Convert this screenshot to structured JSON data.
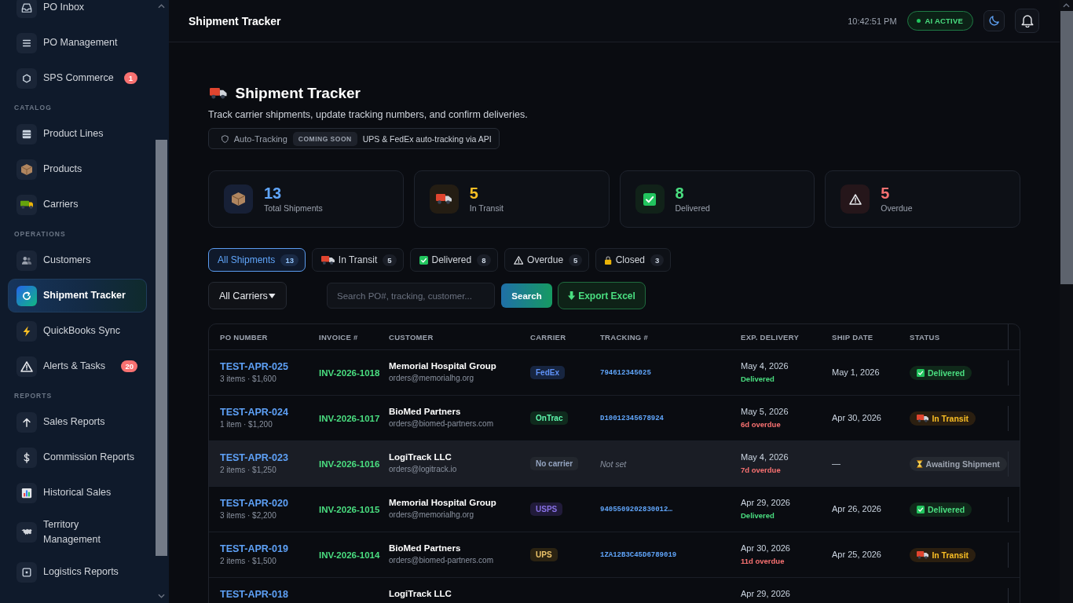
{
  "sidebar": {
    "groups": [
      {
        "items": [
          {
            "label": "PO Inbox",
            "kind": "inbox",
            "selected": false
          },
          {
            "label": "PO Management",
            "kind": "list",
            "selected": false
          },
          {
            "label": "SPS Commerce",
            "kind": "hexagon",
            "selected": false,
            "badge": "1"
          }
        ]
      },
      {
        "label": "CATALOG",
        "items": [
          {
            "label": "Product Lines",
            "kind": "table",
            "selected": false
          },
          {
            "label": "Products",
            "kind": "box",
            "selected": false
          },
          {
            "label": "Carriers",
            "kind": "lorry",
            "selected": false
          }
        ]
      },
      {
        "label": "OPERATIONS",
        "items": [
          {
            "label": "Customers",
            "kind": "people",
            "selected": false
          },
          {
            "label": "Shipment Tracker",
            "kind": "refresh",
            "selected": true
          },
          {
            "label": "QuickBooks Sync",
            "kind": "bolt",
            "selected": false
          },
          {
            "label": "Alerts & Tasks",
            "kind": "warning",
            "selected": false,
            "badge": "20"
          }
        ]
      },
      {
        "label": "REPORTS",
        "items": [
          {
            "label": "Sales Reports",
            "kind": "arrow",
            "selected": false
          },
          {
            "label": "Commission Reports",
            "kind": "dollar",
            "selected": false
          },
          {
            "label": "Historical Sales",
            "kind": "chart",
            "selected": false
          },
          {
            "label": "Territory Management",
            "kind": "map",
            "selected": false
          },
          {
            "label": "Logistics Reports",
            "kind": "square",
            "selected": false
          }
        ]
      }
    ]
  },
  "header": {
    "title": "Shipment Tracker",
    "time": "10:42:51 PM",
    "status": "AI ACTIVE"
  },
  "page": {
    "title": "Shipment Tracker",
    "subtitle": "Track carrier shipments, update tracking numbers, and confirm deliveries.",
    "notice": {
      "label": "Auto-Tracking",
      "badge": "COMING SOON",
      "text": "UPS & FedEx auto-tracking via API"
    }
  },
  "stats": [
    {
      "value": "13",
      "label": "Total Shipments",
      "kind": "total"
    },
    {
      "value": "5",
      "label": "In Transit",
      "kind": "transit"
    },
    {
      "value": "8",
      "label": "Delivered",
      "kind": "delivered"
    },
    {
      "value": "5",
      "label": "Overdue",
      "kind": "overdue"
    }
  ],
  "tabs": [
    {
      "label": "All Shipments",
      "count": "13",
      "kind": "all",
      "selected": true
    },
    {
      "label": "In Transit",
      "count": "5",
      "kind": "transit",
      "selected": false
    },
    {
      "label": "Delivered",
      "count": "8",
      "kind": "delivered",
      "selected": false
    },
    {
      "label": "Overdue",
      "count": "5",
      "kind": "overdue",
      "selected": false
    },
    {
      "label": "Closed",
      "count": "3",
      "kind": "closed",
      "selected": false
    }
  ],
  "filters": {
    "carrier": "All Carriers",
    "search": {
      "placeholder": "Search PO#, tracking, customer..."
    },
    "buttons": [
      {
        "label": "Search",
        "kind": "search"
      },
      {
        "label": "Export Excel",
        "kind": "export"
      }
    ]
  },
  "table": {
    "columns": [
      "PO NUMBER",
      "INVOICE #",
      "CUSTOMER",
      "CARRIER",
      "TRACKING #",
      "EXP. DELIVERY",
      "SHIP DATE",
      "STATUS"
    ],
    "rows": [
      {
        "selected": false,
        "po": "TEST-APR-025",
        "summary": "3 items · $1,600",
        "invoice": "INV-2026-1018",
        "customer": "Memorial Hospital Group",
        "email": "orders@memorialhg.org",
        "carrier": {
          "label": "FedEx",
          "color": "#172540"
        },
        "tracking": {
          "text": "794612345025",
          "kind": "number"
        },
        "expected": {
          "date": "May 4, 2026",
          "note": "Delivered",
          "kind": "delivered"
        },
        "ship_date": "May 1, 2026",
        "status": {
          "label": "Delivered",
          "kind": "delivered"
        }
      },
      {
        "selected": false,
        "po": "TEST-APR-024",
        "summary": "1 item · $1,200",
        "invoice": "INV-2026-1017",
        "customer": "BioMed Partners",
        "email": "orders@biomed-partners.com",
        "carrier": {
          "label": "OnTrac",
          "color": "#0f2a1d"
        },
        "tracking": {
          "text": "D10012345678924",
          "kind": "number"
        },
        "expected": {
          "date": "May 5, 2026",
          "note": "6d overdue",
          "kind": "overdue"
        },
        "ship_date": "Apr 30, 2026",
        "status": {
          "label": "In Transit",
          "kind": "transit"
        }
      },
      {
        "selected": true,
        "po": "TEST-APR-023",
        "summary": "2 items · $1,250",
        "invoice": "INV-2026-1016",
        "customer": "LogiTrack LLC",
        "email": "orders@logitrack.io",
        "carrier": {
          "label": "No carrier",
          "color": "#23272e"
        },
        "tracking": {
          "text": "Not set",
          "kind": "missing"
        },
        "expected": {
          "date": "May 4, 2026",
          "note": "7d overdue",
          "kind": "overdue"
        },
        "ship_date": "—",
        "status": {
          "label": "Awaiting Shipment",
          "kind": "awaiting"
        }
      },
      {
        "selected": false,
        "po": "TEST-APR-020",
        "summary": "3 items · $2,200",
        "invoice": "INV-2026-1015",
        "customer": "Memorial Hospital Group",
        "email": "orders@memorialhg.org",
        "carrier": {
          "label": "USPS",
          "color": "#211b3a"
        },
        "tracking": {
          "text": "9405509202830012…",
          "kind": "number"
        },
        "expected": {
          "date": "Apr 29, 2026",
          "note": "Delivered",
          "kind": "delivered"
        },
        "ship_date": "Apr 26, 2026",
        "status": {
          "label": "Delivered",
          "kind": "delivered"
        }
      },
      {
        "selected": false,
        "po": "TEST-APR-019",
        "summary": "2 items · $1,500",
        "invoice": "INV-2026-1014",
        "customer": "BioMed Partners",
        "email": "orders@biomed-partners.com",
        "carrier": {
          "label": "UPS",
          "color": "#2b2312"
        },
        "tracking": {
          "text": "1ZA12B3C45D6789019",
          "kind": "number"
        },
        "expected": {
          "date": "Apr 30, 2026",
          "note": "11d overdue",
          "kind": "overdue"
        },
        "ship_date": "Apr 25, 2026",
        "status": {
          "label": "In Transit",
          "kind": "transit"
        }
      },
      {
        "selected": false,
        "po": "TEST-APR-018",
        "customer": "LogiTrack LLC",
        "expected": {
          "date": "Apr 29, 2026"
        }
      }
    ]
  }
}
